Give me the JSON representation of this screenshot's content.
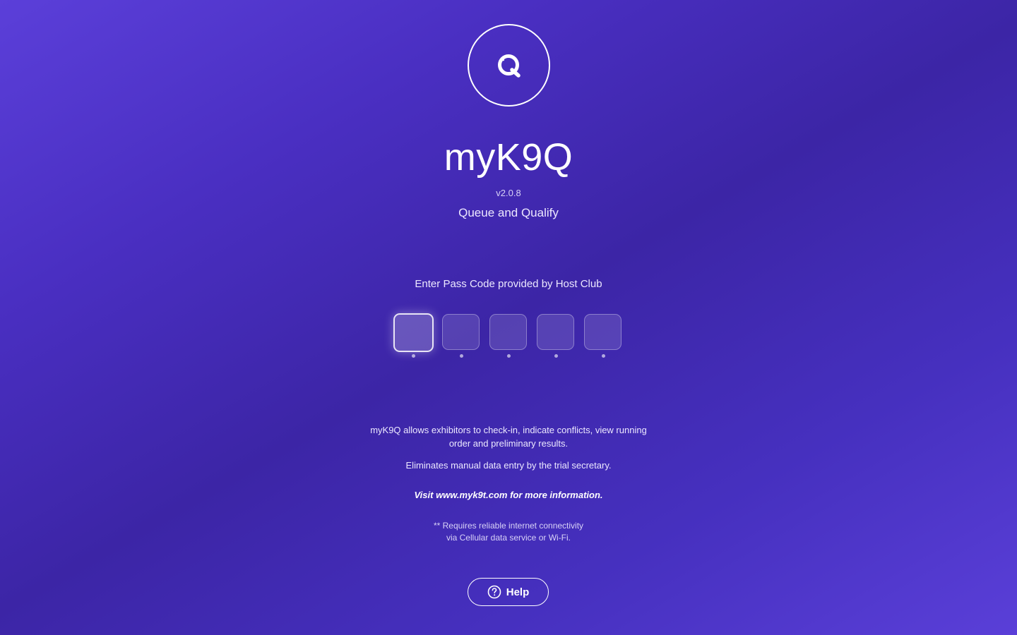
{
  "app": {
    "name": "myK9Q",
    "version": "v2.0.8",
    "tagline": "Queue and Qualify",
    "logo_icon": "myk9q-logo-q-icon"
  },
  "passcode": {
    "prompt": "Enter Pass Code provided by Host Club",
    "length": 5,
    "values": [
      "",
      "",
      "",
      "",
      ""
    ]
  },
  "info": {
    "description": "myK9Q allows exhibitors to check-in, indicate conflicts, view running order and preliminary results.",
    "eliminates": "Eliminates manual data entry by the trial secretary.",
    "visit": "Visit www.myk9t.com for more information.",
    "requirement_line1": "** Requires reliable internet connectivity",
    "requirement_line2": "via Cellular data service or Wi-Fi."
  },
  "help": {
    "label": "Help",
    "icon": "question-circle-icon"
  },
  "colors": {
    "background_start": "#5b3fd9",
    "background_mid": "#3c25a6",
    "text": "#ffffff"
  }
}
